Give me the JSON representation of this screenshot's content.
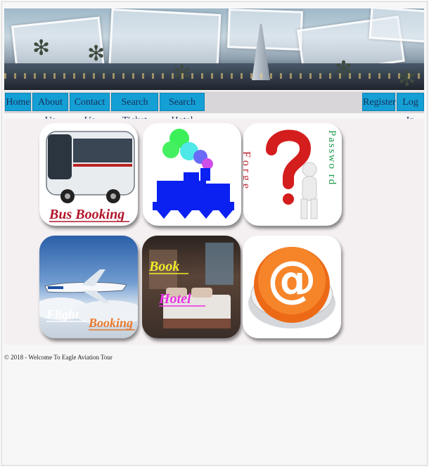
{
  "nav": {
    "left": [
      "Home",
      "About Us",
      "Contact Us",
      "Search Ticket",
      "Search Hotel"
    ],
    "register": "Register",
    "login": "Log In"
  },
  "tiles": {
    "bus": "Bus Booking",
    "forgot_left": "Forge",
    "forgot_right": "Passwo rd",
    "flight_word": "Flight",
    "flight_booking": "Booking",
    "hotel_book": "Book",
    "hotel_word": "Hotel",
    "email_symbol": "@"
  },
  "footer": {
    "text": "© 2018 - Welcome To Eagle Aviation Tour"
  },
  "colors": {
    "nav": "#149fd5",
    "nav_text": "#17315a",
    "train": "#0b21f2"
  }
}
